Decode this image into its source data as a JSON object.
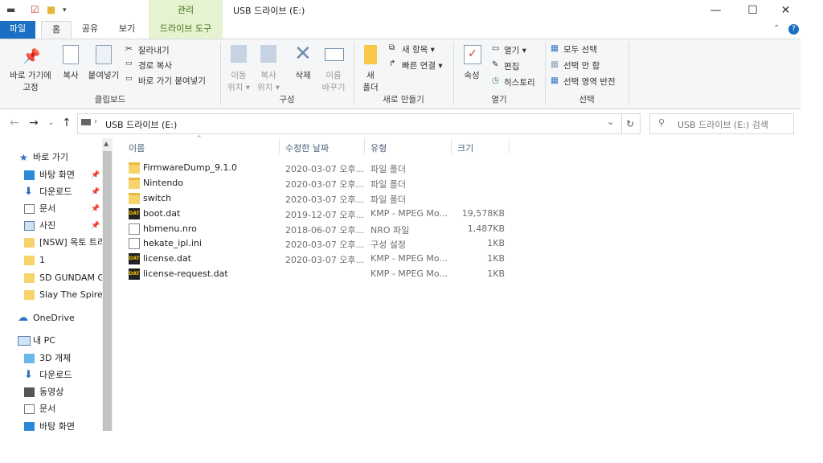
{
  "window": {
    "title": "USB 드라이브 (E:)",
    "contextual_tab_header": "관리",
    "controls": {
      "minimize": "—",
      "maximize": "☐",
      "close": "✕"
    }
  },
  "tabs": [
    "파일",
    "홈",
    "공유",
    "보기",
    "드라이브 도구"
  ],
  "ribbon": {
    "clipboard": {
      "pin_label_1": "바로 가기에",
      "pin_label_2": "고정",
      "copy": "복사",
      "paste": "붙여넣기",
      "cut": "잘라내기",
      "copy_path": "경로 복사",
      "paste_shortcut": "바로 가기 붙여넣기",
      "group": "클립보드"
    },
    "organize": {
      "move_1": "이동",
      "move_2": "위치 ▾",
      "copy_1": "복사",
      "copy_2": "위치 ▾",
      "delete": "삭제",
      "rename_1": "이름",
      "rename_2": "바꾸기",
      "group": "구성"
    },
    "new": {
      "folder_1": "새",
      "folder_2": "폴더",
      "new_item": "새 항목 ▾",
      "easy_access": "빠른 연결 ▾",
      "group": "새로 만들기"
    },
    "open": {
      "properties": "속성",
      "open": "열기 ▾",
      "edit": "편집",
      "history": "히스토리",
      "group": "열기"
    },
    "select": {
      "select_all": "모두 선택",
      "select_none": "선택 안 함",
      "invert": "선택 영역 반전",
      "group": "선택"
    }
  },
  "address": {
    "path": "USB 드라이브 (E:)",
    "search_placeholder": "USB 드라이브 (E:) 검색"
  },
  "nav": {
    "quick_access": "바로 가기",
    "items": [
      {
        "label": "바탕 화면",
        "pinned": true
      },
      {
        "label": "다운로드",
        "pinned": true
      },
      {
        "label": "문서",
        "pinned": true
      },
      {
        "label": "사진",
        "pinned": true
      },
      {
        "label": "[NSW] 옥토 트리",
        "pinned": false
      },
      {
        "label": "1",
        "pinned": false
      },
      {
        "label": "SD GUNDAM G",
        "pinned": false
      },
      {
        "label": "Slay The Spire N",
        "pinned": false
      }
    ],
    "onedrive": "OneDrive",
    "this_pc": "내 PC",
    "pc_items": [
      "3D 개체",
      "다운로드",
      "동영상",
      "문서",
      "바탕 화면"
    ]
  },
  "columns": {
    "name": "이름",
    "date": "수정한 날짜",
    "type": "유형",
    "size": "크기"
  },
  "files": [
    {
      "name": "FirmwareDump_9.1.0",
      "date": "2020-03-07 오후...",
      "type": "파일 폴더",
      "size": "",
      "icon": "folder"
    },
    {
      "name": "Nintendo",
      "date": "2020-03-07 오후...",
      "type": "파일 폴더",
      "size": "",
      "icon": "folder"
    },
    {
      "name": "switch",
      "date": "2020-03-07 오후...",
      "type": "파일 폴더",
      "size": "",
      "icon": "folder"
    },
    {
      "name": "boot.dat",
      "date": "2019-12-07 오후...",
      "type": "KMP - MPEG Mo...",
      "size": "19,578KB",
      "icon": "kmp"
    },
    {
      "name": "hbmenu.nro",
      "date": "2018-06-07 오후...",
      "type": "NRO 파일",
      "size": "1,487KB",
      "icon": "doc"
    },
    {
      "name": "hekate_ipl.ini",
      "date": "2020-03-07 오후...",
      "type": "구성 설정",
      "size": "1KB",
      "icon": "ini"
    },
    {
      "name": "license.dat",
      "date": "2020-03-07 오후...",
      "type": "KMP - MPEG Mo...",
      "size": "1KB",
      "icon": "kmp"
    },
    {
      "name": "license-request.dat",
      "date": "",
      "type": "KMP - MPEG Mo...",
      "size": "1KB",
      "icon": "kmp"
    }
  ]
}
